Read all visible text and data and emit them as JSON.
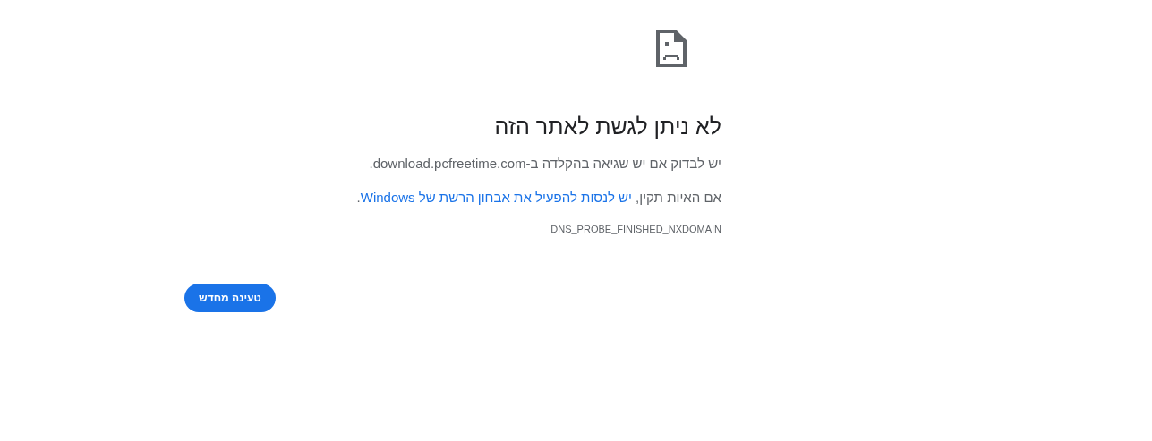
{
  "error_page": {
    "title": "לא ניתן לגשת לאתר הזה",
    "message": "יש לבדוק אם יש שגיאה בהקלדה ב-download.pcfreetime.com.",
    "suggestion": {
      "before": "אם האיות תקין, ",
      "link": "יש לנסות להפעיל את אבחון הרשת של Windows",
      "after": "."
    },
    "error_code": "DNS_PROBE_FINISHED_NXDOMAIN",
    "reload_button": "טעינה מחדש"
  }
}
